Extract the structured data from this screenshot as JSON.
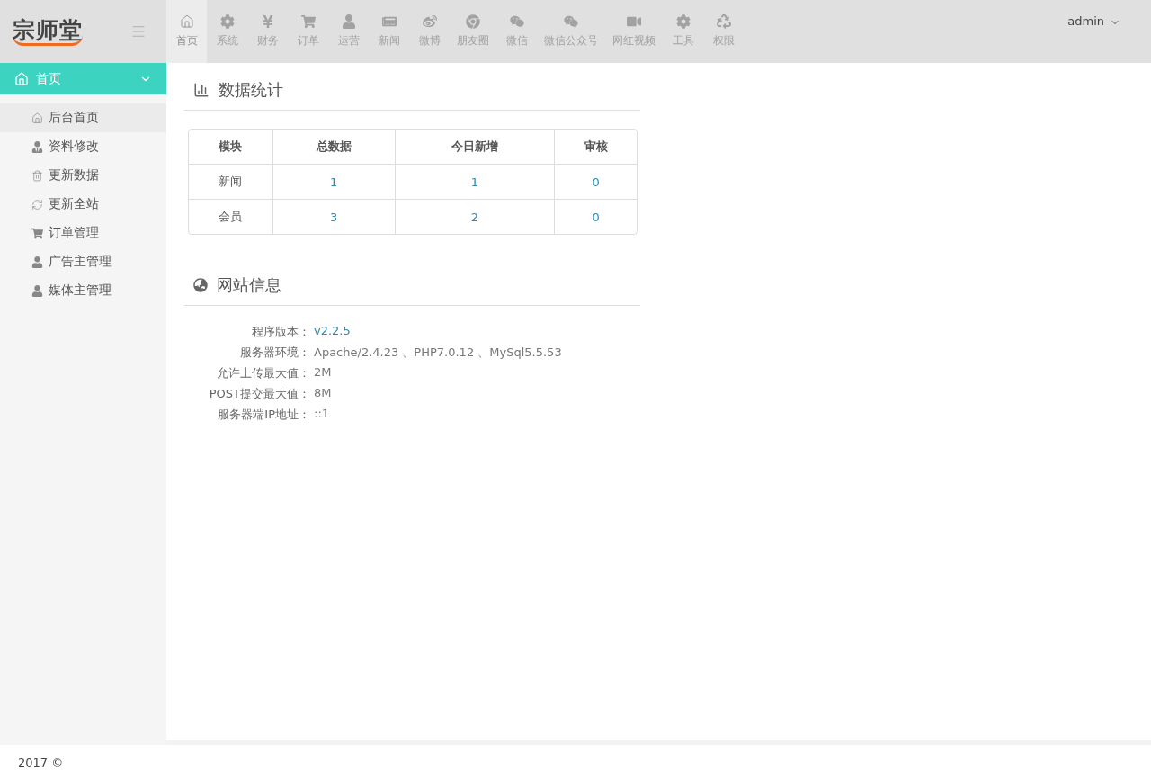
{
  "logo": {
    "text": "宗师堂"
  },
  "top_nav": [
    {
      "label": "首页",
      "selected": true
    },
    {
      "label": "系统",
      "selected": false
    },
    {
      "label": "财务",
      "selected": false
    },
    {
      "label": "订单",
      "selected": false
    },
    {
      "label": "运营",
      "selected": false
    },
    {
      "label": "新闻",
      "selected": false
    },
    {
      "label": "微博",
      "selected": false
    },
    {
      "label": "朋友圈",
      "selected": false
    },
    {
      "label": "微信",
      "selected": false
    },
    {
      "label": "微信公众号",
      "selected": false
    },
    {
      "label": "网红视频",
      "selected": false
    },
    {
      "label": "工具",
      "selected": false
    },
    {
      "label": "权限",
      "selected": false
    }
  ],
  "user_menu": {
    "label": "admin"
  },
  "sidebar": {
    "group": {
      "label": "首页",
      "expanded": true
    },
    "items": [
      {
        "label": "后台首页",
        "selected": true
      },
      {
        "label": "资料修改",
        "selected": false
      },
      {
        "label": "更新数据",
        "selected": false
      },
      {
        "label": "更新全站",
        "selected": false
      },
      {
        "label": "订单管理",
        "selected": false
      },
      {
        "label": "广告主管理",
        "selected": false
      },
      {
        "label": "媒体主管理",
        "selected": false
      }
    ]
  },
  "stats": {
    "title": "数据统计",
    "columns": [
      "模块",
      "总数据",
      "今日新增",
      "审核"
    ],
    "rows": [
      [
        "新闻",
        "1",
        "1",
        "0"
      ],
      [
        "会员",
        "3",
        "2",
        "0"
      ]
    ]
  },
  "site_info": {
    "title": "网站信息",
    "rows": [
      {
        "label": "程序版本：",
        "value": "v2.2.5",
        "kind": "link"
      },
      {
        "label": "服务器环境：",
        "value": "Apache/2.4.23 、PHP7.0.12 、MySql5.5.53",
        "kind": "text"
      },
      {
        "label": "允许上传最大值：",
        "value": "2M",
        "kind": "text"
      },
      {
        "label": "POST提交最大值：",
        "value": "8M",
        "kind": "text"
      },
      {
        "label": "服务器端IP地址：",
        "value": "::1",
        "kind": "text"
      }
    ]
  },
  "footer": {
    "text": "2017 ©"
  }
}
